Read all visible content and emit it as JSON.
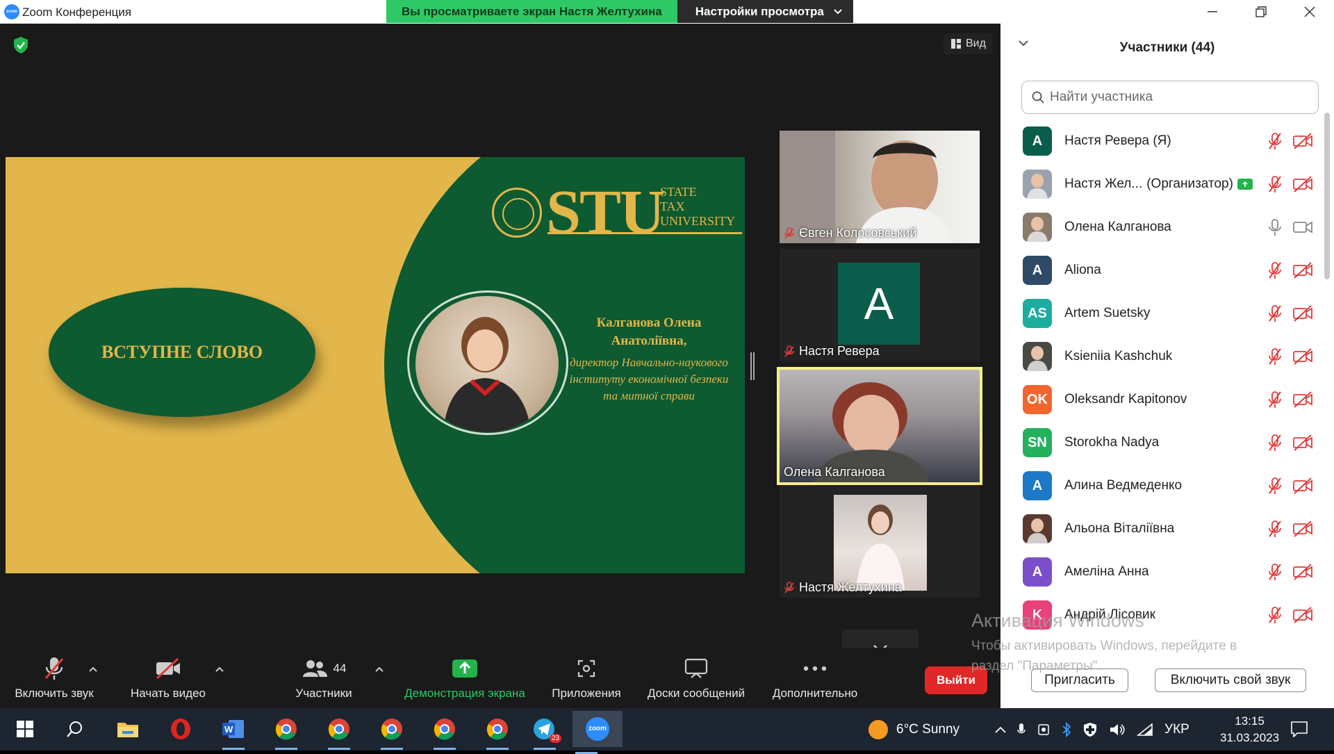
{
  "window": {
    "app_logo_text": "zoom",
    "title": "Zoom Конференция",
    "share_viewing": "Вы просматриваете экран Настя Желтухина",
    "view_settings": "Настройки просмотра"
  },
  "stage": {
    "view_label": "Вид"
  },
  "slide": {
    "oval_text": "ВСТУПНЕ СЛОВО",
    "logo_big": "STU",
    "logo_line1": "STATE",
    "logo_line2": "TAX",
    "logo_line3": "UNIVERSITY",
    "speaker_name_line1": "Калганова Олена",
    "speaker_name_line2": "Анатоліївна,",
    "speaker_role": "директор Навчально-наукового інституту економічної безпеки та митної справи"
  },
  "tiles": [
    {
      "name": "Євген Колосовський",
      "muted": true
    },
    {
      "name": "Настя Ревера",
      "muted": true,
      "avatar": "A"
    },
    {
      "name": "Олена Калганова",
      "muted": false
    },
    {
      "name": "Настя Желтухина",
      "muted": true
    }
  ],
  "toolbar": {
    "unmute": "Включить звук",
    "start_video": "Начать видео",
    "participants": "Участники",
    "participants_count": "44",
    "share_screen": "Демонстрация экрана",
    "apps": "Приложения",
    "whiteboards": "Доски сообщений",
    "more": "Дополнительно",
    "leave": "Выйти"
  },
  "panel": {
    "title": "Участники (44)",
    "search_placeholder": "Найти участника",
    "invite": "Пригласить",
    "unmute_self": "Включить свой звук",
    "participants": [
      {
        "name": "Настя Ревера (Я)",
        "initials": "A",
        "color": "#0B5D4B",
        "mic": "off",
        "cam": "off"
      },
      {
        "name": "Настя Жел...",
        "suffix": "(Организатор)",
        "initials": "",
        "color": "#9aa3ad",
        "photo": true,
        "sharing": true,
        "mic": "off",
        "cam": "off"
      },
      {
        "name": "Олена Калганова",
        "initials": "",
        "color": "#8a7a6a",
        "photo": true,
        "mic": "on",
        "cam": "on"
      },
      {
        "name": "Aliona",
        "initials": "A",
        "color": "#2E4A66",
        "mic": "off",
        "cam": "off"
      },
      {
        "name": "Artem Suetsky",
        "initials": "AS",
        "color": "#1BAE9F",
        "mic": "off",
        "cam": "off"
      },
      {
        "name": "Ksieniia Kashchuk",
        "initials": "",
        "color": "#4a4a44",
        "photo": true,
        "mic": "off",
        "cam": "off"
      },
      {
        "name": "Oleksandr Kapitonov",
        "initials": "OK",
        "color": "#F2662E",
        "mic": "off",
        "cam": "off"
      },
      {
        "name": "Storokha Nadya",
        "initials": "SN",
        "color": "#24B15C",
        "mic": "off",
        "cam": "off"
      },
      {
        "name": "Алина Ведмеденко",
        "initials": "A",
        "color": "#1E78C8",
        "mic": "off",
        "cam": "off"
      },
      {
        "name": "Альона Віталіївна",
        "initials": "",
        "color": "#5a3a30",
        "photo": true,
        "mic": "off",
        "cam": "off"
      },
      {
        "name": "Амеліна Анна",
        "initials": "A",
        "color": "#7B4FCB",
        "mic": "off",
        "cam": "off"
      },
      {
        "name": "Андрій Лісовик",
        "initials": "K",
        "color": "#E8417B",
        "mic": "off",
        "cam": "off"
      }
    ]
  },
  "watermark": {
    "line1": "Активация Windows",
    "line2": "Чтобы активировать Windows, перейдите в",
    "line3": "раздел \"Параметры\"."
  },
  "taskbar": {
    "weather": "6°C  Sunny",
    "lang": "УКР",
    "time": "13:15",
    "date": "31.03.2023",
    "telegram_badge": "23",
    "zoom_label": "zoom"
  },
  "colors": {
    "zoom_blue": "#2D8CFF",
    "share_green": "#22B34A",
    "leave_red": "#E02828",
    "slide_gold": "#E2B64A",
    "slide_green": "#0E5A31",
    "mic_off_red": "#E03A3A"
  }
}
